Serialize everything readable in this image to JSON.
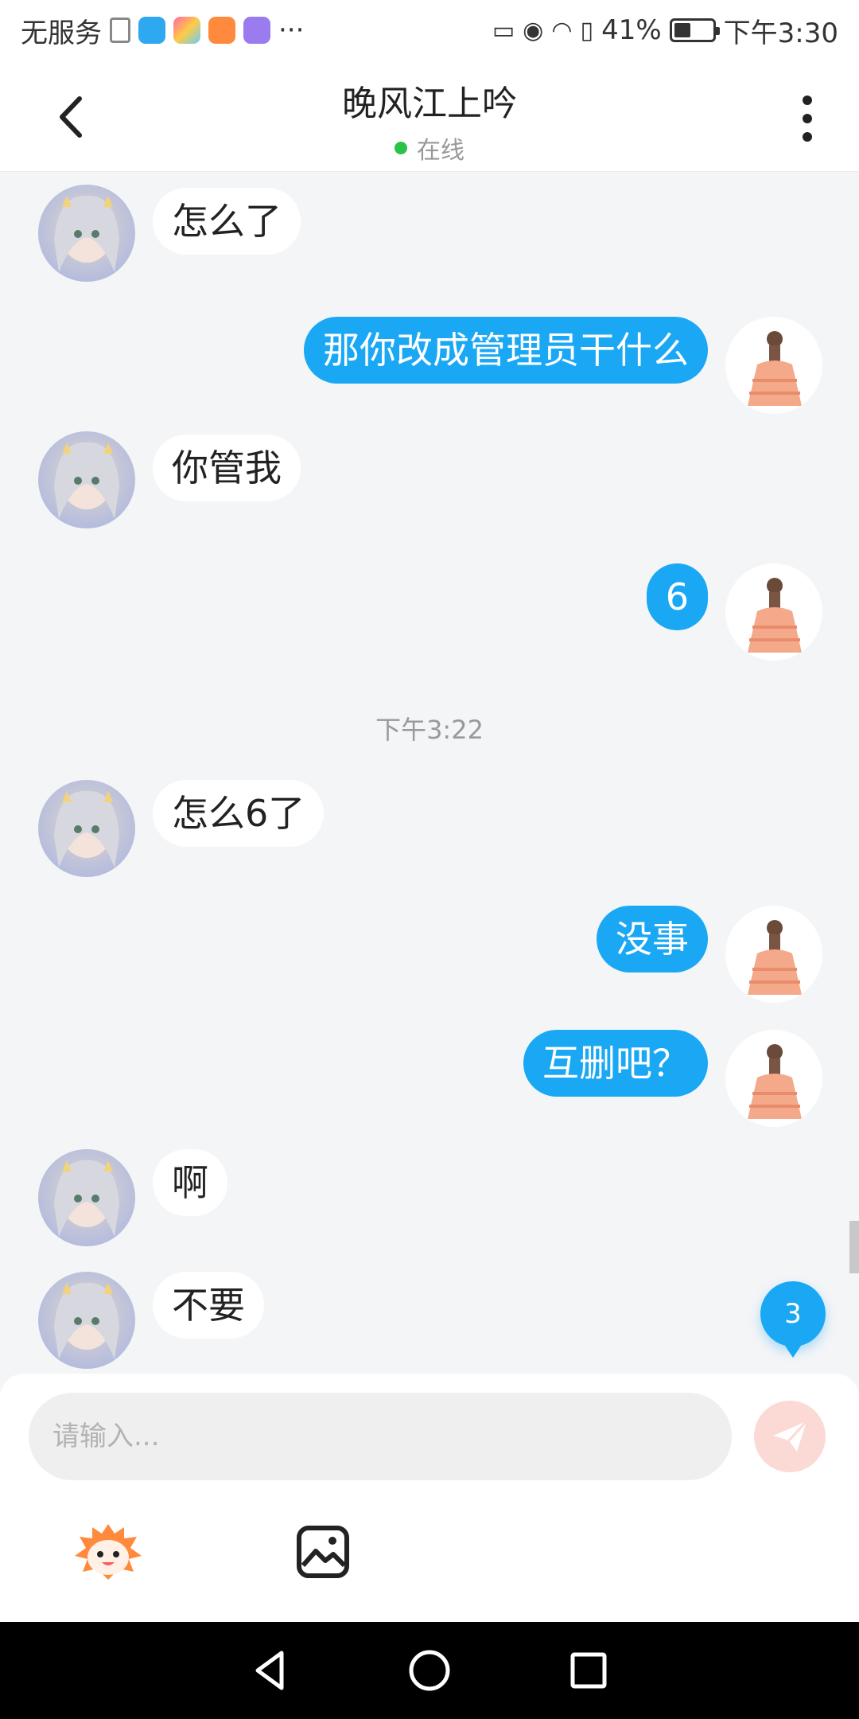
{
  "status_bar": {
    "carrier": "无服务",
    "overflow": "···",
    "battery": "41%",
    "time": "下午3:30",
    "icons": [
      "doc-icon",
      "shield-app-icon",
      "paint-app-icon",
      "video-app-icon",
      "clock-app-icon",
      "no-sim-icon",
      "eye-icon",
      "wifi-icon",
      "alert-battery-icon",
      "battery-icon"
    ]
  },
  "header": {
    "title": "晚风江上吟",
    "status": "在线",
    "back_icon": "chevron-left-icon",
    "more_icon": "more-vertical-icon"
  },
  "messages": [
    {
      "side": "them",
      "text": "怎么了"
    },
    {
      "side": "me",
      "text": "那你改成管理员干什么"
    },
    {
      "side": "them",
      "text": "你管我"
    },
    {
      "side": "me",
      "text": "6"
    },
    {
      "side": "time",
      "text": "下午3:22"
    },
    {
      "side": "them",
      "text": "怎么6了"
    },
    {
      "side": "me",
      "text": "没事"
    },
    {
      "side": "me",
      "text": "互删吧？"
    },
    {
      "side": "them",
      "text": "啊"
    },
    {
      "side": "them",
      "text": "不要"
    }
  ],
  "unread_badge": "3",
  "input": {
    "placeholder": "请输入...",
    "value": "",
    "send_icon": "paper-plane-icon"
  },
  "toolbar": {
    "emoji_icon": "emoji-mascot-icon",
    "image_icon": "image-icon"
  },
  "nav": {
    "back_icon": "nav-back-icon",
    "home_icon": "nav-home-icon",
    "recents_icon": "nav-recents-icon"
  },
  "colors": {
    "my_bubble": "#1aa8f5",
    "their_bubble": "#ffffff",
    "online": "#2bc24a",
    "send_button": "#fbd9d5",
    "background": "#f4f5f7"
  }
}
